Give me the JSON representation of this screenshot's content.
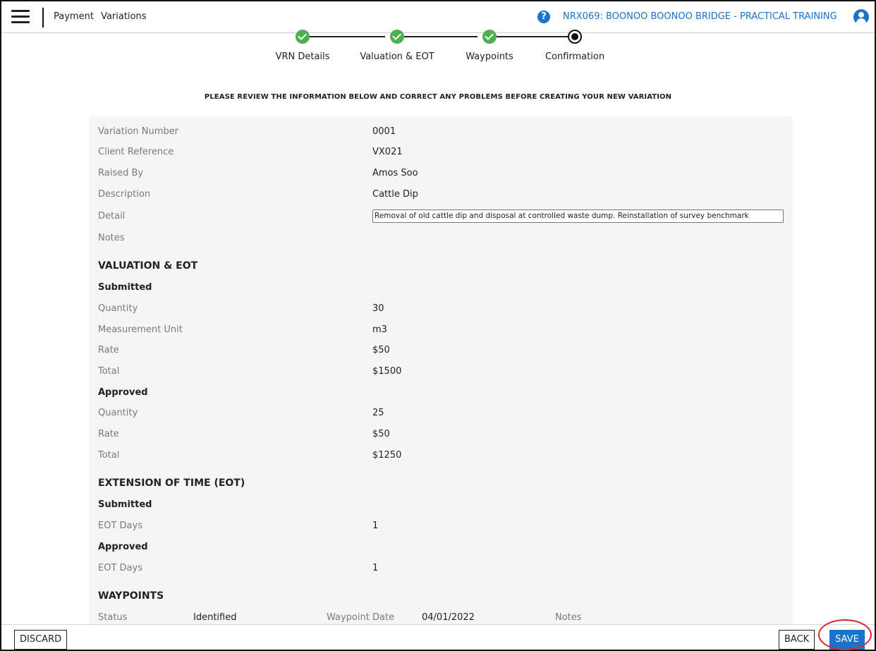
{
  "header": {
    "breadcrumb": [
      "Payment",
      "Variations"
    ],
    "project_title": "NRX069: BOONOO BOONOO BRIDGE - PRACTICAL TRAINING",
    "help_icon": "?"
  },
  "stepper": {
    "steps": [
      {
        "label": "VRN Details",
        "state": "done"
      },
      {
        "label": "Valuation & EOT",
        "state": "done"
      },
      {
        "label": "Waypoints",
        "state": "done"
      },
      {
        "label": "Confirmation",
        "state": "current"
      }
    ]
  },
  "notice": "PLEASE REVIEW THE INFORMATION BELOW AND CORRECT ANY PROBLEMS BEFORE CREATING YOUR NEW VARIATION",
  "details": {
    "variation_number": {
      "label": "Variation Number",
      "value": "0001"
    },
    "client_reference": {
      "label": "Client Reference",
      "value": "VX021"
    },
    "raised_by": {
      "label": "Raised By",
      "value": "Amos Soo"
    },
    "description": {
      "label": "Description",
      "value": "Cattle Dip"
    },
    "detail": {
      "label": "Detail",
      "value": "Removal of old cattle dip and disposal at controlled waste dump. Reinstallation of survey benchmark"
    },
    "notes": {
      "label": "Notes",
      "value": ""
    }
  },
  "valuation": {
    "title": "VALUATION & EOT",
    "submitted": {
      "heading": "Submitted",
      "quantity": {
        "label": "Quantity",
        "value": "30"
      },
      "unit": {
        "label": "Measurement Unit",
        "value": "m3"
      },
      "rate": {
        "label": "Rate",
        "value": "$50"
      },
      "total": {
        "label": "Total",
        "value": "$1500"
      }
    },
    "approved": {
      "heading": "Approved",
      "quantity": {
        "label": "Quantity",
        "value": "25"
      },
      "rate": {
        "label": "Rate",
        "value": "$50"
      },
      "total": {
        "label": "Total",
        "value": "$1250"
      }
    }
  },
  "eot": {
    "title": "EXTENSION OF TIME (EOT)",
    "submitted": {
      "heading": "Submitted",
      "label": "EOT Days",
      "value": "1"
    },
    "approved": {
      "heading": "Approved",
      "label": "EOT Days",
      "value": "1"
    }
  },
  "waypoints": {
    "title": "WAYPOINTS",
    "status_label": "Status",
    "status_value": "Identified",
    "date_label": "Waypoint Date",
    "date_value": "04/01/2022",
    "notes_label": "Notes"
  },
  "footer": {
    "discard": "DISCARD",
    "back": "BACK",
    "save": "SAVE"
  },
  "colors": {
    "accent": "#1a73c9",
    "step_done": "#4caf50",
    "highlight_ring": "#d9262b"
  }
}
